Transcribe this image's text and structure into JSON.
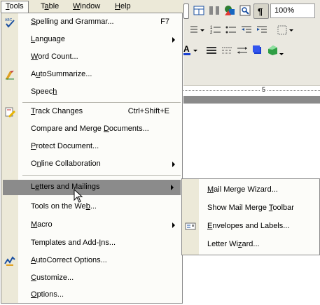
{
  "menubar": {
    "items": [
      {
        "pre": "",
        "u": "T",
        "post": "ools"
      },
      {
        "pre": "T",
        "u": "a",
        "post": "ble"
      },
      {
        "pre": "",
        "u": "W",
        "post": "indow"
      },
      {
        "pre": "",
        "u": "H",
        "post": "elp"
      }
    ]
  },
  "toolbar": {
    "zoom": "100%",
    "ruler_number": "5"
  },
  "tools_menu": {
    "spelling": {
      "pre": "",
      "u": "S",
      "post": "pelling and Grammar...",
      "shortcut": "F7"
    },
    "language": {
      "pre": "",
      "u": "L",
      "post": "anguage"
    },
    "word_count": {
      "pre": "",
      "u": "W",
      "post": "ord Count..."
    },
    "autosummarize": {
      "pre": "A",
      "u": "u",
      "post": "toSummarize..."
    },
    "speech": {
      "pre": "Speec",
      "u": "h",
      "post": ""
    },
    "track_changes": {
      "pre": "",
      "u": "T",
      "post": "rack Changes",
      "shortcut": "Ctrl+Shift+E"
    },
    "compare_merge": {
      "pre": "Compare and Merge ",
      "u": "D",
      "post": "ocuments..."
    },
    "protect": {
      "pre": "",
      "u": "P",
      "post": "rotect Document..."
    },
    "online_collab": {
      "pre": "O",
      "u": "n",
      "post": "line Collaboration"
    },
    "letters_mailings": {
      "pre": "L",
      "u": "e",
      "post": "tters and Mailings"
    },
    "tools_web": {
      "pre": "Tools on the We",
      "u": "b",
      "post": "..."
    },
    "macro": {
      "pre": "",
      "u": "M",
      "post": "acro"
    },
    "templates": {
      "pre": "Templates and Add-",
      "u": "I",
      "post": "ns..."
    },
    "autocorrect": {
      "pre": "",
      "u": "A",
      "post": "utoCorrect Options..."
    },
    "customize": {
      "pre": "",
      "u": "C",
      "post": "ustomize..."
    },
    "options": {
      "pre": "",
      "u": "O",
      "post": "ptions..."
    }
  },
  "submenu": {
    "mail_merge_wizard": {
      "pre": "",
      "u": "M",
      "post": "ail Merge Wizard..."
    },
    "show_toolbar": {
      "pre": "Show Mail Merge ",
      "u": "T",
      "post": "oolbar"
    },
    "envelopes": {
      "pre": "",
      "u": "E",
      "post": "nvelopes and Labels..."
    },
    "letter_wizard": {
      "pre": "Letter Wi",
      "u": "z",
      "post": "ard..."
    }
  }
}
